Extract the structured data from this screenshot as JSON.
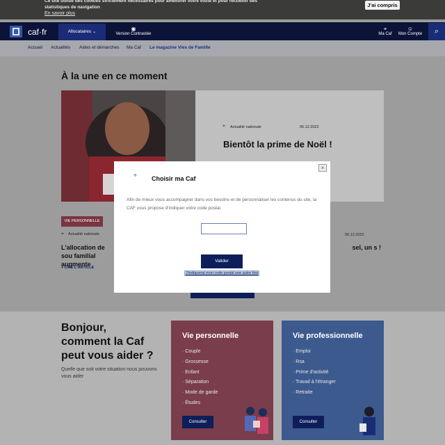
{
  "cookie_bar": {
    "text": "Ce site utilise des cookies strictement nécessaires pour améliorer votre visite et pour recueillir des statistiques de navigation",
    "more_link": "En savoir plus",
    "accept_button": "J'ai compris"
  },
  "header": {
    "logo_text": "caf·fr",
    "audience_dropdown": "Allocataires",
    "contrast_label": "Version Contrastée",
    "macaf_label": "Ma Caf",
    "account_label": "Mon Compte"
  },
  "nav": {
    "items": [
      "Accueil",
      "Actualités",
      "Aides et démarches",
      "Ma Caf",
      "Le magazine Vies de Famille"
    ]
  },
  "main": {
    "heading": "À la une en ce moment",
    "featured": {
      "category": "Actualité nationale",
      "date": "06.12.2022",
      "title": "Bientôt la prime de Noël !"
    },
    "article2": {
      "tag": "VIE PERSONNELLE",
      "category": "Actualité nationale",
      "title": "L'allocation de sou familial augmente",
      "read": "LIRE L'ARTICLE"
    },
    "article3": {
      "date": "06.12.2022",
      "title": "sel, un s !"
    }
  },
  "help": {
    "heading": "Bonjour, comment la Caf peut vous aider ?",
    "subtext": "Quelle que soit votre situation nous pouvons vous aider",
    "personal": {
      "title": "Vie personnelle",
      "items": [
        "Couple",
        "Grossesse",
        "Enfant",
        "Séparation",
        "Mode de garde",
        "Études"
      ],
      "button": "Consulter"
    },
    "professional": {
      "title": "Vie professionnelle",
      "items": [
        "Emploi",
        "Rsa",
        "Prime d'activité",
        "Travail à l'étranger",
        "Retraite"
      ],
      "button": "Consulter"
    }
  },
  "modal": {
    "title": "Choisir ma Caf",
    "text": "Afin de mieux vous accompagner dans vos besoins et de personnaliser les contenus du site, la CAF vous propose d'indiquer votre code postal.",
    "postal_value": "",
    "submit": "Valider",
    "later": "J'indiquerai mon code postal une autre fois"
  }
}
